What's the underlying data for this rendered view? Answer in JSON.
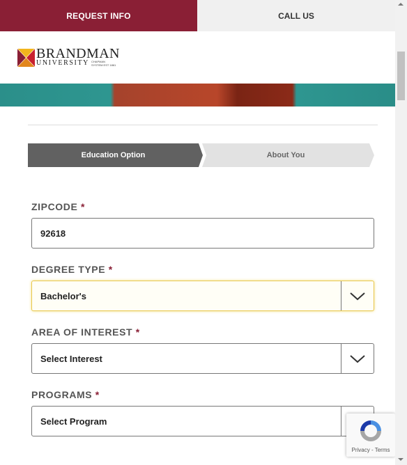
{
  "top_bar": {
    "request_label": "REQUEST INFO",
    "call_label": "CALL US"
  },
  "logo": {
    "name": "BRANDMAN",
    "sub": "UNIVERSITY",
    "small": "CHAPMAN SYSTEM EST 1861",
    "colors": {
      "mark_red": "#8a1f35",
      "mark_yellow": "#f2b51d"
    }
  },
  "steps": [
    {
      "label": "Education Option",
      "active": true
    },
    {
      "label": "About You",
      "active": false
    }
  ],
  "form": {
    "zipcode": {
      "label": "ZIPCODE",
      "required": "*",
      "value": "92618"
    },
    "degree_type": {
      "label": "DEGREE TYPE",
      "required": "*",
      "value": "Bachelor's"
    },
    "area_of_interest": {
      "label": "AREA OF INTEREST",
      "required": "*",
      "value": "Select Interest"
    },
    "programs": {
      "label": "PROGRAMS",
      "required": "*",
      "value": "Select Program"
    }
  },
  "recaptcha": {
    "privacy": "Privacy",
    "separator": " - ",
    "terms": "Terms"
  },
  "colors": {
    "brand": "#8a1f35",
    "step_active": "#616161",
    "step_inactive": "#e2e2e2",
    "focus": "#e8c74c"
  }
}
